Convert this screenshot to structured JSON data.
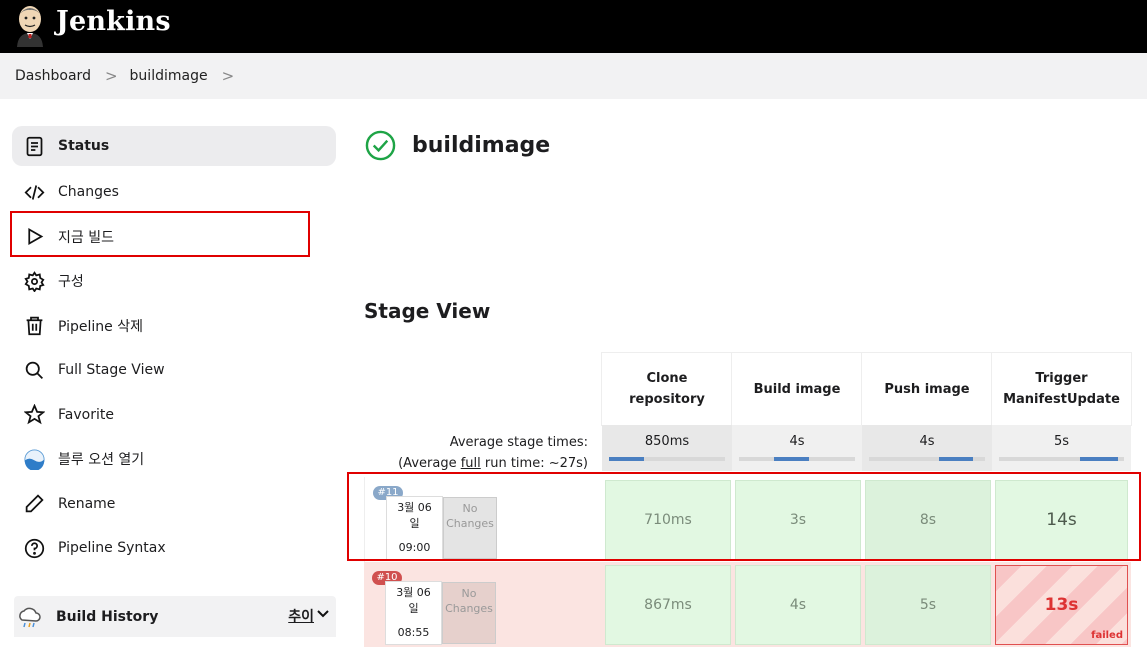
{
  "header": {
    "brand": "Jenkins"
  },
  "breadcrumb": {
    "items": [
      "Dashboard",
      "buildimage"
    ],
    "separator": ">"
  },
  "sidebar": {
    "items": [
      {
        "label": "Status",
        "icon": "document-icon"
      },
      {
        "label": "Changes",
        "icon": "code-icon"
      },
      {
        "label": "지금 빌드",
        "icon": "play-icon"
      },
      {
        "label": "구성",
        "icon": "gear-icon"
      },
      {
        "label": "Pipeline 삭제",
        "icon": "trash-icon"
      },
      {
        "label": "Full Stage View",
        "icon": "search-icon"
      },
      {
        "label": "Favorite",
        "icon": "star-icon"
      },
      {
        "label": "블루 오션 열기",
        "icon": "blue-ocean-icon"
      },
      {
        "label": "Rename",
        "icon": "pencil-icon"
      },
      {
        "label": "Pipeline Syntax",
        "icon": "help-icon"
      }
    ]
  },
  "build_history": {
    "title": "Build History",
    "trend": "추이"
  },
  "main": {
    "job_name": "buildimage",
    "stage_view_title": "Stage View"
  },
  "stage_view": {
    "stages": [
      "Clone repository",
      "Build image",
      "Push image",
      "Trigger ManifestUpdate"
    ],
    "average_label": "Average stage times:",
    "average_run_prefix": "(Average ",
    "average_run_link": "full",
    "average_run_suffix": " run time: ~27s)",
    "average_times": [
      "850ms",
      "4s",
      "4s",
      "5s"
    ],
    "average_fill": [
      0.0,
      0.3,
      0.6,
      0.65
    ],
    "runs": [
      {
        "number": "#11",
        "date_line1": "3월 06",
        "date_line2": "일",
        "time": "09:00",
        "changes_line1": "No",
        "changes_line2": "Changes",
        "status": "success",
        "durations": [
          "710ms",
          "3s",
          "8s",
          "14s"
        ]
      },
      {
        "number": "#10",
        "date_line1": "3월 06",
        "date_line2": "일",
        "time": "08:55",
        "changes_line1": "No",
        "changes_line2": "Changes",
        "status": "failed",
        "durations": [
          "867ms",
          "4s",
          "5s",
          "13s"
        ],
        "failed_label": "failed"
      }
    ]
  },
  "colors": {
    "success_cell": "#e3f8e3",
    "success_cell_alt": "#dcf3dc",
    "failed_row": "#fbe4e1",
    "badge_success": "#8aa8c9",
    "badge_failed": "#d0504f",
    "highlight": "#e00000"
  }
}
